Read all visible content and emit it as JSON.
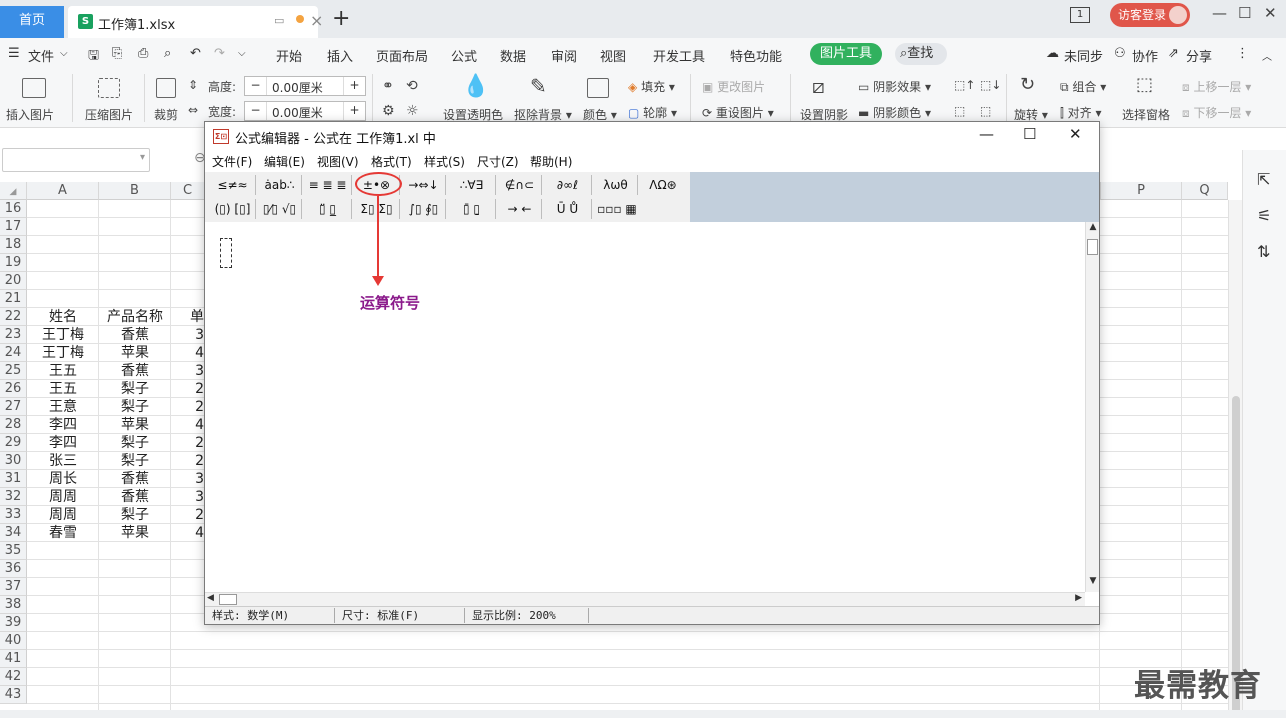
{
  "titlebar": {
    "home_tab": "首页",
    "file_tab": "工作簿1.xlsx",
    "new_tab": "+",
    "window_number": "1",
    "visitor_login": "访客登录"
  },
  "menubar": {
    "file_menu": "文件",
    "tabs": [
      "开始",
      "插入",
      "页面布局",
      "公式",
      "数据",
      "审阅",
      "视图",
      "开发工具",
      "特色功能"
    ],
    "picture_tools": "图片工具",
    "search": "查找",
    "not_synced": "未同步",
    "collaborate": "协作",
    "share": "分享"
  },
  "ribbon": {
    "insert_picture": "插入图片",
    "compress_picture": "压缩图片",
    "crop": "裁剪",
    "height_label": "高度:",
    "height_value": "0.00厘米",
    "width_label": "宽度:",
    "width_value": "0.00厘米",
    "set_transparent": "设置透明色",
    "remove_background": "抠除背景",
    "color": "颜色",
    "fill": "填充",
    "outline": "轮廓",
    "change_picture": "更改图片",
    "reset_picture": "重设图片",
    "set_shadow": "设置阴影",
    "shadow_effect": "阴影效果",
    "shadow_color": "阴影颜色",
    "rotate": "旋转",
    "group": "组合",
    "align": "对齐",
    "selection_pane": "选择窗格",
    "bring_forward": "上移一层",
    "send_backward": "下移一层"
  },
  "sheet": {
    "columns": [
      "A",
      "B",
      "C",
      "P",
      "Q"
    ],
    "rows": [
      "16",
      "17",
      "18",
      "19",
      "20",
      "21",
      "22",
      "23",
      "24",
      "25",
      "26",
      "27",
      "28",
      "29",
      "30",
      "31",
      "32",
      "33",
      "34",
      "35",
      "36",
      "37",
      "38",
      "39",
      "40",
      "41",
      "42",
      "43"
    ],
    "header": {
      "name": "姓名",
      "product": "产品名称",
      "unit": "单"
    },
    "records": [
      {
        "name": "王丁梅",
        "product": "香蕉",
        "c": "3"
      },
      {
        "name": "王丁梅",
        "product": "苹果",
        "c": "4"
      },
      {
        "name": "王五",
        "product": "香蕉",
        "c": "3"
      },
      {
        "name": "王五",
        "product": "梨子",
        "c": "2"
      },
      {
        "name": "王意",
        "product": "梨子",
        "c": "2"
      },
      {
        "name": "李四",
        "product": "苹果",
        "c": "4"
      },
      {
        "name": "李四",
        "product": "梨子",
        "c": "2"
      },
      {
        "name": "张三",
        "product": "梨子",
        "c": "2"
      },
      {
        "name": "周长",
        "product": "香蕉",
        "c": "3"
      },
      {
        "name": "周周",
        "product": "香蕉",
        "c": "3"
      },
      {
        "name": "周周",
        "product": "梨子",
        "c": "2"
      },
      {
        "name": "春雪",
        "product": "苹果",
        "c": "4"
      }
    ]
  },
  "dialog": {
    "title": "公式编辑器 - 公式在 工作簿1.xl 中",
    "menu": [
      "文件(F)",
      "编辑(E)",
      "视图(V)",
      "格式(T)",
      "样式(S)",
      "尺寸(Z)",
      "帮助(H)"
    ],
    "toolbar_row1": [
      "≤≠≈",
      "ȧab∴",
      "≡ ≣ ≣",
      "±•⊗",
      "→⇔↓",
      "∴∀∃",
      "∉∩⊂",
      "∂∞ℓ",
      "λωθ",
      "ΛΩ⊛"
    ],
    "toolbar_row2": [
      "(▯) [▯]",
      "▯⁄▯ √▯",
      "▯̈ ▯̲",
      "Σ▯ Σ▯",
      "∫▯ ∮▯",
      "▯̄ ▯̱",
      "→ ←",
      "Ū Ů",
      "▫▫▫ ▦"
    ],
    "status": {
      "style": "样式: 数学(M)",
      "size": "尺寸: 标准(F)",
      "zoom": "显示比例: 200%"
    }
  },
  "annotation": {
    "label": "运算符号"
  },
  "watermark": "最需教育"
}
